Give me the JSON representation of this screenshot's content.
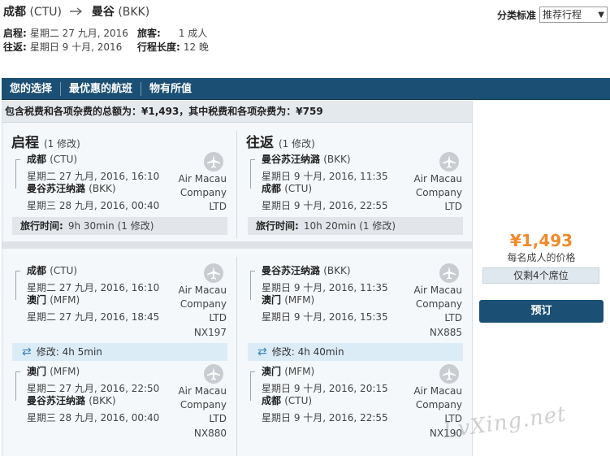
{
  "header": {
    "origin_city": "成都",
    "origin_code": "(CTU)",
    "dest_city": "曼谷",
    "dest_code": "(BKK)",
    "depart_label": "启程:",
    "depart_value": "星期二 27 九月, 2016",
    "return_label": "往返:",
    "return_value": "星期日 9 十月, 2016",
    "passengers_label": "旅客:",
    "passengers_value": "1 成人",
    "length_label": "行程长度:",
    "length_value": "12 晚",
    "sort_label": "分类标准",
    "sort_value": "推荐行程"
  },
  "tabs": [
    "您的选择",
    "最优惠的航班",
    "物有所值"
  ],
  "total_text": "包含税费和各项杂费的总额为：¥1,493，其中税费和各项杂费为：¥759",
  "selected": {
    "outbound": {
      "heading": "启程",
      "mods": "(1 修改)",
      "from_name": "成都",
      "from_code": "(CTU)",
      "from_time": "星期二 27 九月, 2016, 16:10",
      "to_name": "曼谷苏汪纳潞",
      "to_code": "(BKK)",
      "to_time": "星期三 28 九月, 2016, 00:40",
      "airline": [
        "Air Macau",
        "Company",
        "LTD"
      ],
      "duration_label": "旅行时间:",
      "duration_value": "9h 30min (1 修改)"
    },
    "inbound": {
      "heading": "往返",
      "mods": "(1 修改)",
      "from_name": "曼谷苏汪纳潞",
      "from_code": "(BKK)",
      "from_time": "星期日 9 十月, 2016, 11:35",
      "to_name": "成都",
      "to_code": "(CTU)",
      "to_time": "星期日 9 十月, 2016, 22:55",
      "airline": [
        "Air Macau",
        "Company",
        "LTD"
      ],
      "duration_label": "旅行时间:",
      "duration_value": "10h 20min (1 修改)"
    }
  },
  "details": {
    "outbound": {
      "leg1": {
        "from_name": "成都",
        "from_code": "(CTU)",
        "from_time": "星期二 27 九月, 2016, 16:10",
        "to_name": "澳门",
        "to_code": "(MFM)",
        "to_time": "星期二 27 九月, 2016, 18:45",
        "airline": [
          "Air Macau",
          "Company",
          "LTD"
        ],
        "flight_no": "NX197"
      },
      "layover": "修改: 4h 5min",
      "leg2": {
        "from_name": "澳门",
        "from_code": "(MFM)",
        "from_time": "星期二 27 九月, 2016, 22:50",
        "to_name": "曼谷苏汪纳潞",
        "to_code": "(BKK)",
        "to_time": "星期三 28 九月, 2016, 00:40",
        "airline": [
          "Air Macau",
          "Company",
          "LTD"
        ],
        "flight_no": "NX880"
      }
    },
    "inbound": {
      "leg1": {
        "from_name": "曼谷苏汪纳潞",
        "from_code": "(BKK)",
        "from_time": "星期日 9 十月, 2016, 11:35",
        "to_name": "澳门",
        "to_code": "(MFM)",
        "to_time": "星期日 9 十月, 2016, 15:35",
        "airline": [
          "Air Macau",
          "Company",
          "LTD"
        ],
        "flight_no": "NX885"
      },
      "layover": "修改: 4h 40min",
      "leg2": {
        "from_name": "澳门",
        "from_code": "(MFM)",
        "from_time": "星期日 9 十月, 2016, 20:15",
        "to_name": "成都",
        "to_code": "(CTU)",
        "to_time": "星期日 9 十月, 2016, 22:55",
        "airline": [
          "Air Macau",
          "Company",
          "LTD"
        ],
        "flight_no": "NX190"
      }
    }
  },
  "price": {
    "amount": "¥1,493",
    "per_person": "每名成人的价格",
    "seats_left": "仅剩4个席位",
    "book_label": "预订"
  },
  "watermark": "LvXing.net",
  "colors": {
    "nav_bg": "#1b4f73",
    "price": "#f08a2a",
    "layover_bg": "#dcecf7"
  }
}
